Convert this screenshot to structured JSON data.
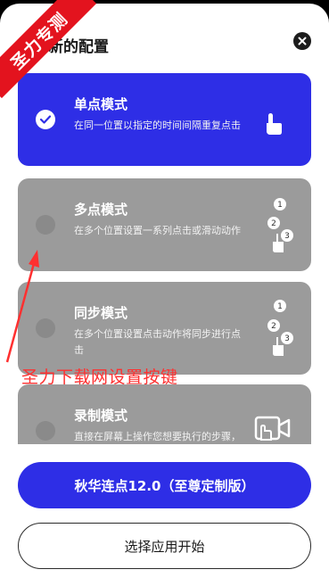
{
  "sheet": {
    "title": "新的配置",
    "close_icon": "close-icon"
  },
  "modes": [
    {
      "title": "单点模式",
      "description": "在同一位置以指定的时间间隔重复点击",
      "selected": true,
      "icon": "single-tap-hand-icon"
    },
    {
      "title": "多点模式",
      "description": "在多个位置设置一系列点击或滑动动作",
      "selected": false,
      "icon": "multi-tap-sequence-icon",
      "icon_numbers": [
        "1",
        "2",
        "3"
      ]
    },
    {
      "title": "同步模式",
      "description": "在多个位置设置点击动作将同步进行点击",
      "selected": false,
      "icon": "sync-tap-sequence-icon",
      "icon_numbers": [
        "1",
        "2",
        "3"
      ]
    },
    {
      "title": "录制模式",
      "description": "直接在屏幕上操作您想要执行的步骤，已标操作将自动添加",
      "selected": false,
      "icon": "screen-record-icon"
    }
  ],
  "buttons": {
    "primary": "秋华连点12.0（至尊定制版）",
    "secondary": "选择应用开始"
  },
  "watermark": {
    "corner_text": "圣力专测",
    "caption": "圣力下载网设置按键"
  },
  "colors": {
    "accent": "#2e2ee6",
    "card_inactive": "#9b9b9b",
    "watermark_red": "#e3131e"
  }
}
